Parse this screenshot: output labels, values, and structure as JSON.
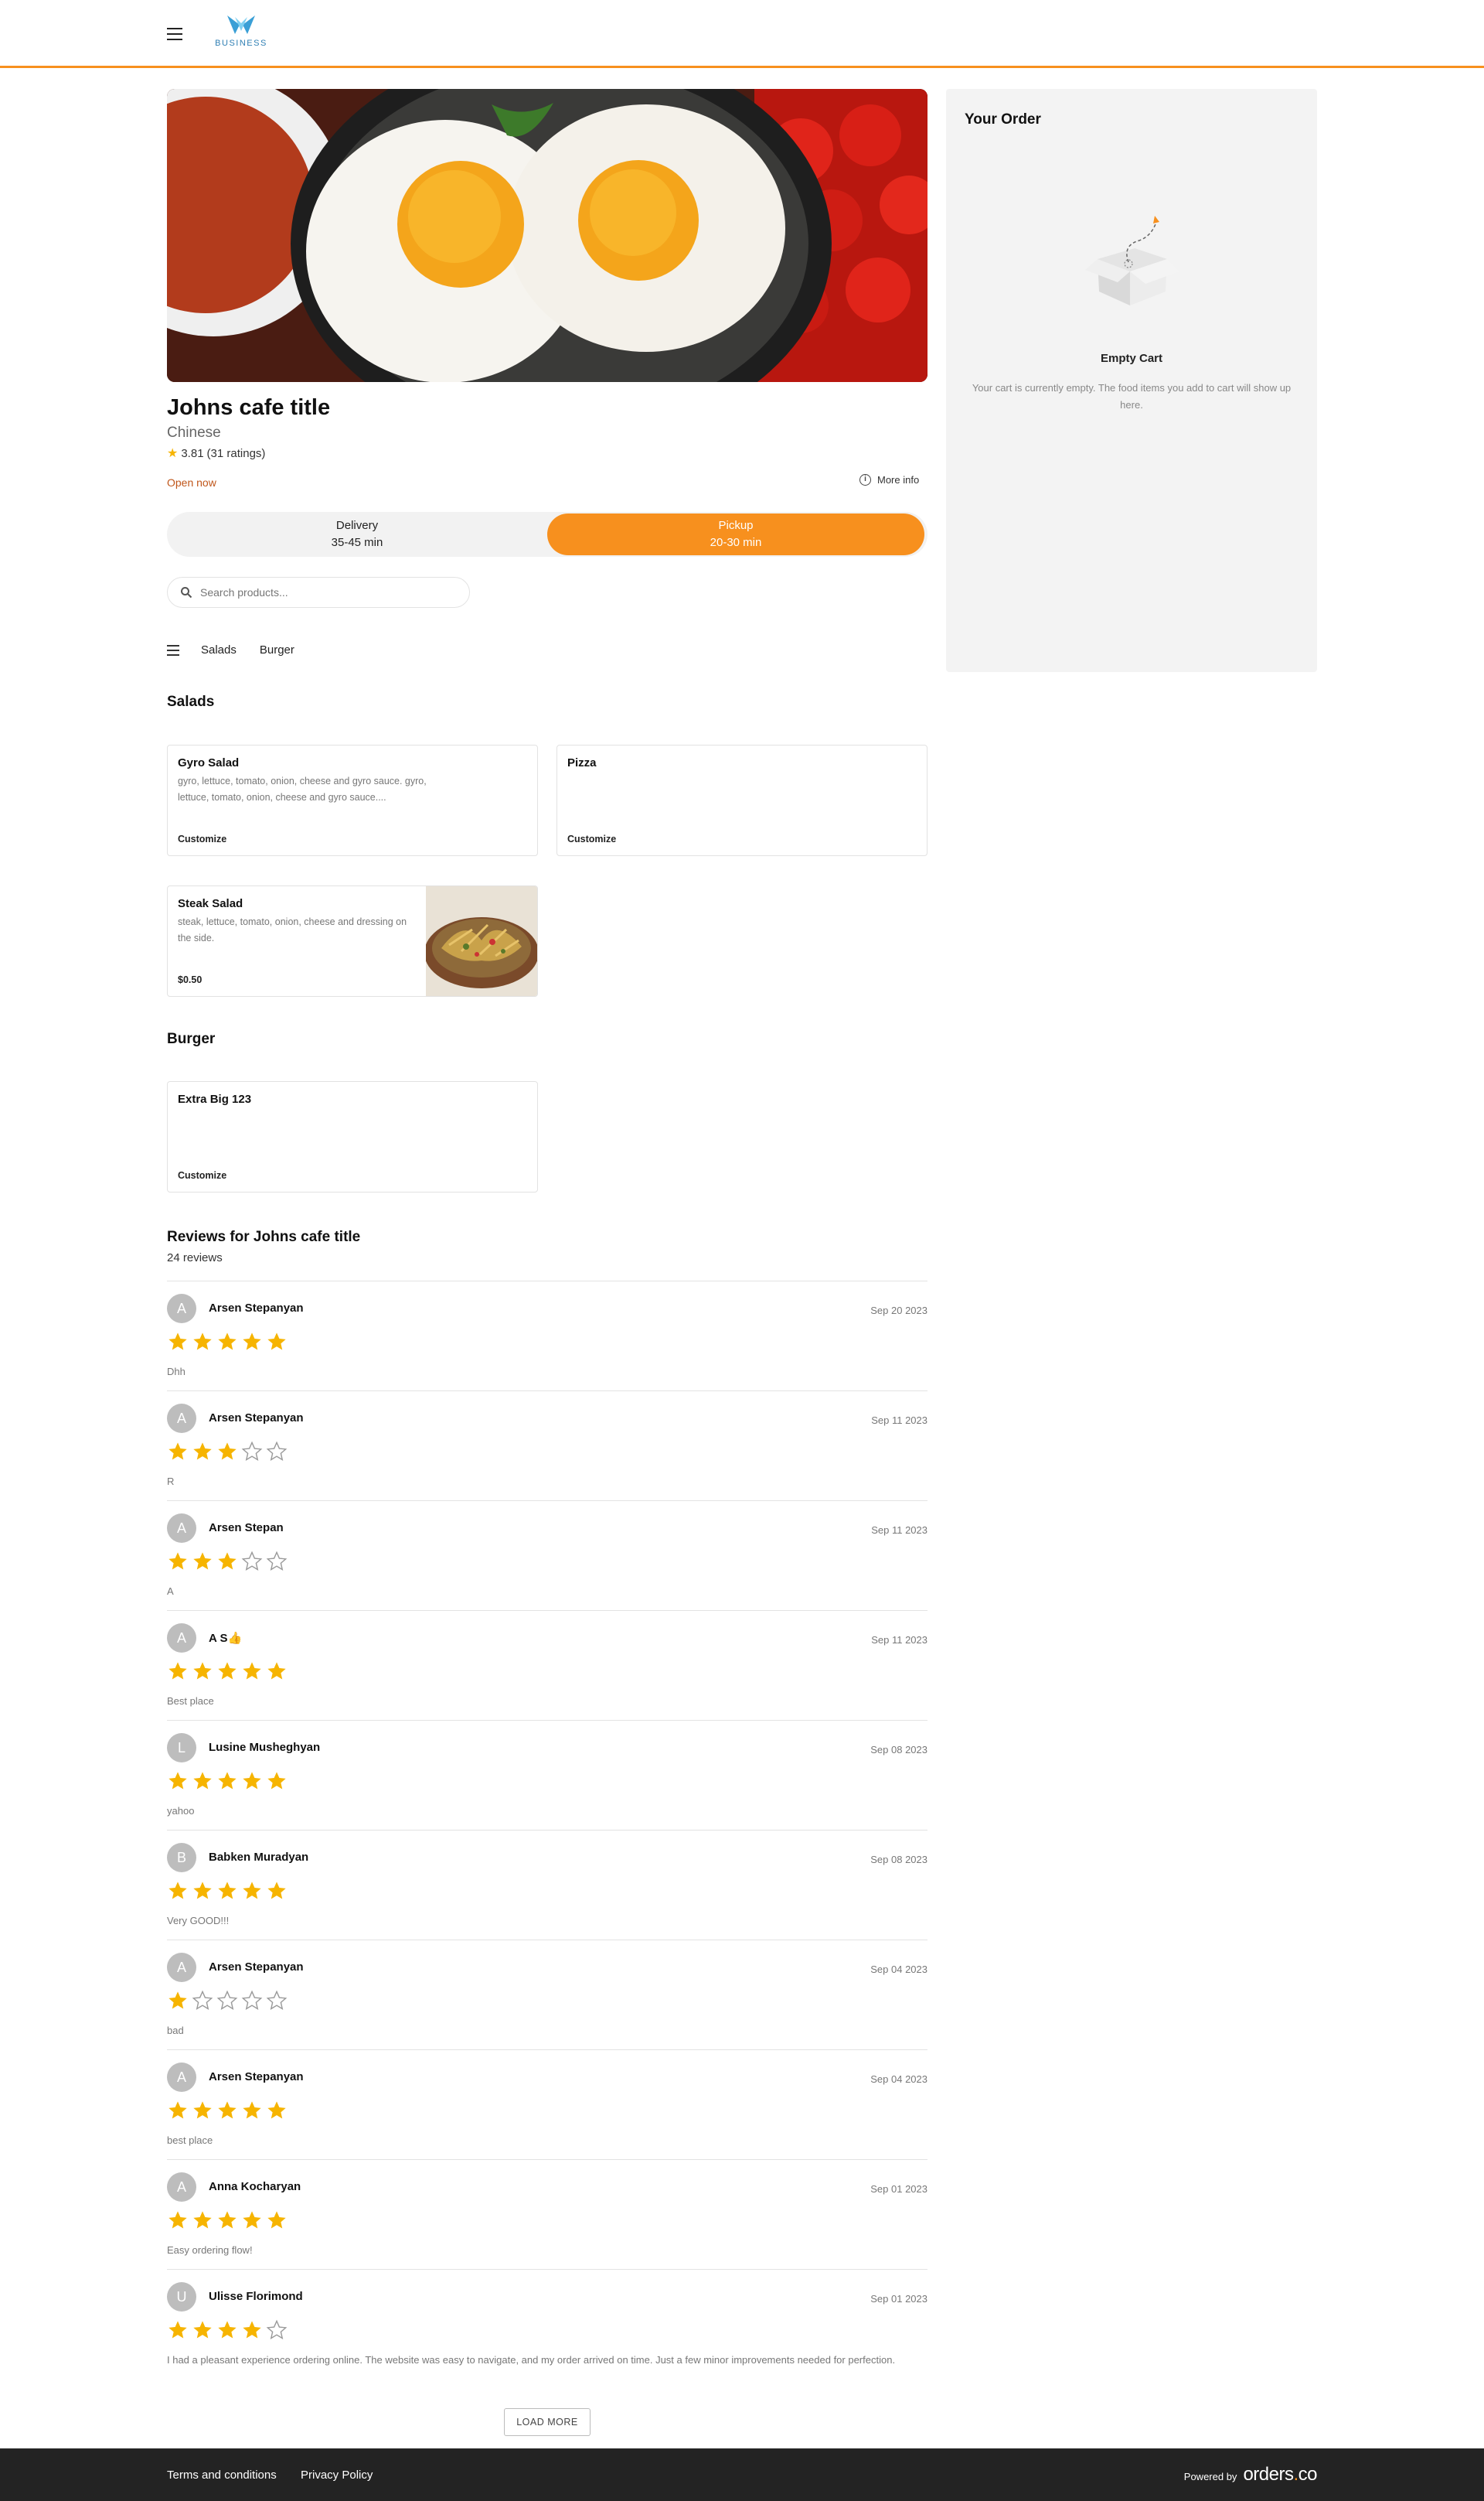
{
  "header": {
    "logo_text": "BUSINESS",
    "accent_color": "#f7901e"
  },
  "store": {
    "title": "Johns cafe title",
    "cuisine": "Chinese",
    "rating": "3.81",
    "ratings_count": "(31 ratings)",
    "status": "Open now",
    "more_info": "More info"
  },
  "modes": {
    "delivery": {
      "label": "Delivery",
      "time": "35-45 min"
    },
    "pickup": {
      "label": "Pickup",
      "time": "20-30 min",
      "selected": true
    }
  },
  "search": {
    "placeholder": "Search products..."
  },
  "categories": [
    "Salads",
    "Burger"
  ],
  "sections": {
    "salads": {
      "title": "Salads",
      "products": [
        {
          "name": "Gyro Salad",
          "desc": "gyro, lettuce, tomato, onion, cheese and gyro sauce. gyro, lettuce, tomato, onion, cheese and gyro sauce....",
          "action": "Customize"
        },
        {
          "name": "Pizza",
          "desc": "",
          "action": "Customize"
        },
        {
          "name": "Steak Salad",
          "desc": "steak, lettuce, tomato, onion, cheese and dressing on the side.",
          "action": "$0.50"
        }
      ]
    },
    "burger": {
      "title": "Burger",
      "products": [
        {
          "name": "Extra Big 123",
          "desc": "",
          "action": "Customize"
        }
      ]
    }
  },
  "reviews": {
    "title": "Reviews for Johns cafe title",
    "count": "24 reviews",
    "items": [
      {
        "initial": "A",
        "name": "Arsen Stepanyan",
        "date": "Sep 20 2023",
        "stars": 5,
        "text": "Dhh"
      },
      {
        "initial": "A",
        "name": "Arsen Stepanyan",
        "date": "Sep 11 2023",
        "stars": 3,
        "text": "R"
      },
      {
        "initial": "A",
        "name": "Arsen Stepan",
        "date": "Sep 11 2023",
        "stars": 3,
        "text": "A"
      },
      {
        "initial": "A",
        "name": "A S👍",
        "date": "Sep 11 2023",
        "stars": 5,
        "text": "Best place"
      },
      {
        "initial": "L",
        "name": "Lusine Musheghyan",
        "date": "Sep 08 2023",
        "stars": 5,
        "text": "yahoo"
      },
      {
        "initial": "B",
        "name": "Babken Muradyan",
        "date": "Sep 08 2023",
        "stars": 5,
        "text": "Very GOOD!!!"
      },
      {
        "initial": "A",
        "name": "Arsen Stepanyan",
        "date": "Sep 04 2023",
        "stars": 1,
        "text": "bad"
      },
      {
        "initial": "A",
        "name": "Arsen Stepanyan",
        "date": "Sep 04 2023",
        "stars": 5,
        "text": "best place"
      },
      {
        "initial": "A",
        "name": "Anna Kocharyan",
        "date": "Sep 01 2023",
        "stars": 5,
        "text": "Easy ordering flow!"
      },
      {
        "initial": "U",
        "name": "Ulisse Florimond",
        "date": "Sep 01 2023",
        "stars": 4,
        "text": "I had a pleasant experience ordering online. The website was easy to navigate, and my order arrived on time. Just a few minor improvements needed for perfection."
      }
    ],
    "load_more": "LOAD MORE",
    "star_color": "#f6b400"
  },
  "cart": {
    "title": "Your Order",
    "empty_title": "Empty Cart",
    "empty_text": "Your cart is currently empty. The food items you add to cart will show up here."
  },
  "footer": {
    "terms": "Terms and conditions",
    "privacy": "Privacy Policy",
    "powered_by": "Powered by",
    "brand": "orders",
    "brand_suffix": "co"
  }
}
